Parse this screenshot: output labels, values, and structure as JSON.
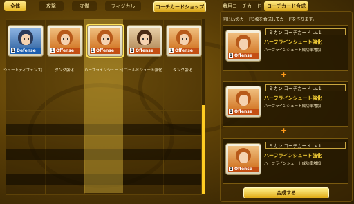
{
  "tabs": {
    "all": "全体",
    "attack": "攻撃",
    "defense": "守備",
    "physical": "フィジカル",
    "shop": "コーチカードショップ"
  },
  "right_tabs": {
    "equipped": "着用コーチカード",
    "compose": "コーチカード合成"
  },
  "cards": [
    {
      "number": "1",
      "type": "Defense",
      "label": "シュートディフェンス強化",
      "hair": "#2a3a5a",
      "band": "#1d5fb0"
    },
    {
      "number": "1",
      "type": "Offense",
      "label": "ダンク強化",
      "hair": "#b85a1a",
      "band": "#c44f14"
    },
    {
      "number": "1",
      "type": "Offense",
      "label": "ハーフラインシュート強化",
      "hair": "#b85a1a",
      "band": "#c44f14"
    },
    {
      "number": "1",
      "type": "Offense",
      "label": "ゴールドシュート強化",
      "hair": "#4a2a14",
      "band": "#c44f14"
    },
    {
      "number": "1",
      "type": "Offense",
      "label": "ダンク強化",
      "hair": "#b85a1a",
      "band": "#c44f14"
    }
  ],
  "compose_panel": {
    "header": "同じLvのカード3枚を合成してカードを作ります。",
    "items": [
      {
        "title": "ミカン コーチカード  Lv.1",
        "skill": "ハーフラインシュート強化",
        "desc": "ハーフラインシュート成功率増加",
        "number": "1",
        "type": "Offense"
      },
      {
        "title": "ミカン コーチカード  Lv.1",
        "skill": "ハーフラインシュート強化",
        "desc": "ハーフラインシュート成功率増加",
        "number": "1",
        "type": "Offense"
      },
      {
        "title": "ミカン コーチカード  Lv.1",
        "skill": "ハーフラインシュート強化",
        "desc": "ハーフラインシュート成功率増加",
        "number": "1",
        "type": "Offense"
      }
    ],
    "compose_button": "合成する"
  }
}
